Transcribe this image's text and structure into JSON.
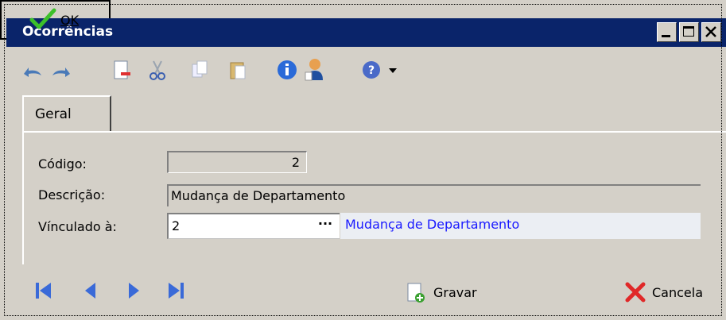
{
  "window": {
    "title": "Ocorrências"
  },
  "toolbar": {
    "icons": [
      "undo-icon",
      "redo-icon",
      "new-record-icon",
      "cut-icon",
      "copy-icon",
      "paste-icon",
      "info-icon",
      "user-icon",
      "help-icon",
      "dropdown-arrow-icon"
    ]
  },
  "tabs": [
    {
      "label": "Geral"
    }
  ],
  "form": {
    "codigo_label": "Código:",
    "codigo_value": "2",
    "descricao_label": "Descrição:",
    "descricao_value": "Mudança de Departamento",
    "vinculado_label": "Vínculado à:",
    "vinculado_value": "2",
    "vinculado_lookup_button": "···",
    "vinculado_description": "Mudança de Departamento"
  },
  "navigation": {
    "icons": [
      "first-record-icon",
      "previous-record-icon",
      "next-record-icon",
      "last-record-icon"
    ]
  },
  "buttons": {
    "gravar": "Gravar",
    "ok": "OK",
    "cancela": "Cancela"
  },
  "colors": {
    "titlebar": "#0a246a",
    "link_text": "#1a1aff",
    "window_bg": "#d4d0c8"
  }
}
